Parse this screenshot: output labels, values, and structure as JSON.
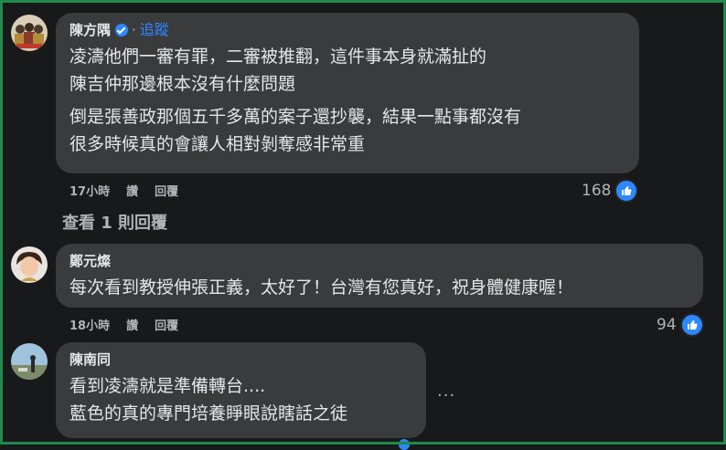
{
  "comments": [
    {
      "author": "陳方隅",
      "verified": true,
      "follow_label": "追蹤",
      "paragraphs": [
        [
          "凌濤他們一審有罪，二審被推翻，這件事本身就滿扯的",
          "陳吉仲那邊根本沒有什麼問題"
        ],
        [
          "倒是張善政那個五千多萬的案子還抄襲，結果一點事都沒有",
          "很多時候真的會讓人相對剝奪感非常重"
        ]
      ],
      "time": "17小時",
      "like_label": "讚",
      "reply_label": "回覆",
      "reactions": "168"
    },
    {
      "author": "鄭元燦",
      "paragraphs": [
        [
          "每次看到教授伸張正義，太好了！台灣有您真好，祝身體健康喔！"
        ]
      ],
      "time": "18小時",
      "like_label": "讚",
      "reply_label": "回覆",
      "reactions": "94"
    },
    {
      "author": "陳南同",
      "paragraphs": [
        [
          "看到凌濤就是準備轉台....",
          "藍色的真的專門培養睜眼說瞎話之徒"
        ]
      ]
    }
  ],
  "view_replies": "查看 1 則回覆",
  "more_options": "...",
  "colors": {
    "background": "#18191a",
    "bubble": "#3a3b3c",
    "accent": "#2d88ff",
    "frame": "#1f8a4c"
  }
}
